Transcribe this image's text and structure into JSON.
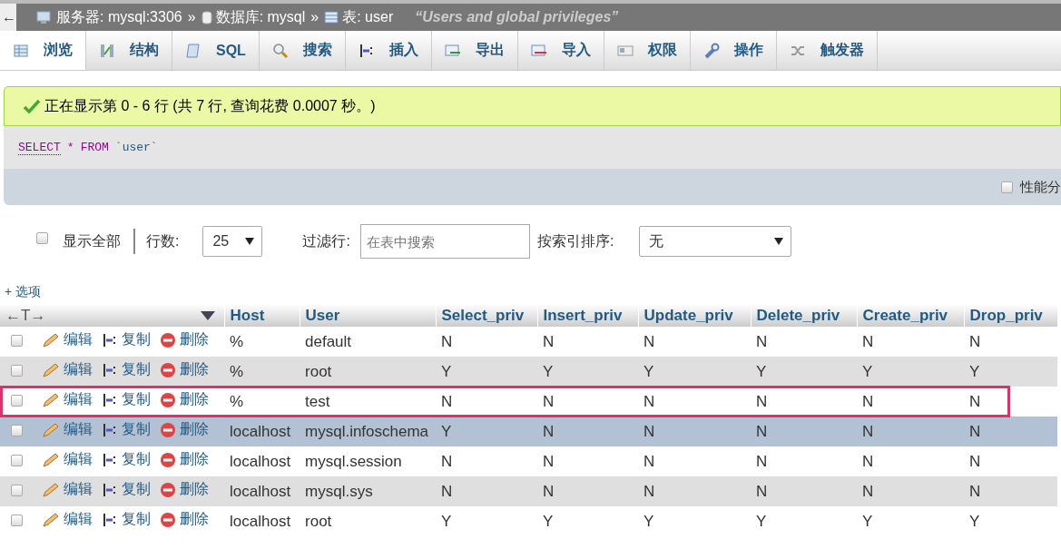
{
  "breadcrumb": {
    "back": "←",
    "items": [
      {
        "kind": "server",
        "label": "服务器: mysql:3306",
        "sep": "»"
      },
      {
        "kind": "database",
        "label": "数据库: mysql",
        "sep": "»"
      },
      {
        "kind": "table",
        "label": "表: user"
      }
    ],
    "comment": "“Users and global privileges”"
  },
  "tabs": [
    {
      "kind": "browse",
      "label": "浏览",
      "selected": true
    },
    {
      "kind": "structure",
      "label": "结构",
      "selected": false
    },
    {
      "kind": "sql",
      "label": "SQL",
      "selected": false
    },
    {
      "kind": "search",
      "label": "搜索",
      "selected": false
    },
    {
      "kind": "insert",
      "label": "插入",
      "selected": false
    },
    {
      "kind": "export",
      "label": "导出",
      "selected": false
    },
    {
      "kind": "import",
      "label": "导入",
      "selected": false
    },
    {
      "kind": "privileges",
      "label": "权限",
      "selected": false
    },
    {
      "kind": "operations",
      "label": "操作",
      "selected": false
    },
    {
      "kind": "triggers",
      "label": "触发器",
      "selected": false
    }
  ],
  "message": "正在显示第 0 - 6 行 (共 7 行, 查询花费 0.0007 秒。)",
  "query": [
    {
      "kind": "keyword",
      "text": "SELECT"
    },
    {
      "kind": "operator",
      "text": "*"
    },
    {
      "kind": "keyword",
      "text": "FROM"
    },
    {
      "kind": "identifier",
      "text": "`user`"
    }
  ],
  "profiling": {
    "label": "性能分",
    "checked": false
  },
  "controls": {
    "show_all": {
      "label": "显示全部",
      "checked": false
    },
    "rows_label": "行数:",
    "rows_value": "25",
    "filter_label": "过滤行:",
    "filter_placeholder": "在表中搜索",
    "sort_label": "按索引排序:",
    "sort_value": "无"
  },
  "options_link": "+ 选项",
  "table": {
    "resize_handle": "←T→",
    "columns": [
      "Host",
      "User",
      "Select_priv",
      "Insert_priv",
      "Update_priv",
      "Delete_priv",
      "Create_priv",
      "Drop_priv"
    ],
    "rows": [
      {
        "checked": false,
        "hover": false,
        "highlighted": false,
        "edit": "编辑",
        "copy": "复制",
        "delete": "删除",
        "cells": [
          "%",
          "default",
          "N",
          "N",
          "N",
          "N",
          "N",
          "N"
        ]
      },
      {
        "checked": false,
        "hover": false,
        "highlighted": false,
        "edit": "编辑",
        "copy": "复制",
        "delete": "删除",
        "cells": [
          "%",
          "root",
          "Y",
          "Y",
          "Y",
          "Y",
          "Y",
          "Y"
        ]
      },
      {
        "checked": false,
        "hover": false,
        "highlighted": true,
        "edit": "编辑",
        "copy": "复制",
        "delete": "删除",
        "cells": [
          "%",
          "test",
          "N",
          "N",
          "N",
          "N",
          "N",
          "N"
        ]
      },
      {
        "checked": false,
        "hover": true,
        "highlighted": false,
        "edit": "编辑",
        "copy": "复制",
        "delete": "删除",
        "cells": [
          "localhost",
          "mysql.infoschema",
          "Y",
          "N",
          "N",
          "N",
          "N",
          "N"
        ]
      },
      {
        "checked": false,
        "hover": false,
        "highlighted": false,
        "edit": "编辑",
        "copy": "复制",
        "delete": "删除",
        "cells": [
          "localhost",
          "mysql.session",
          "N",
          "N",
          "N",
          "N",
          "N",
          "N"
        ]
      },
      {
        "checked": false,
        "hover": false,
        "highlighted": false,
        "edit": "编辑",
        "copy": "复制",
        "delete": "删除",
        "cells": [
          "localhost",
          "mysql.sys",
          "N",
          "N",
          "N",
          "N",
          "N",
          "N"
        ]
      },
      {
        "checked": false,
        "hover": false,
        "highlighted": false,
        "edit": "编辑",
        "copy": "复制",
        "delete": "删除",
        "cells": [
          "localhost",
          "root",
          "Y",
          "Y",
          "Y",
          "Y",
          "Y",
          "Y"
        ]
      }
    ]
  }
}
